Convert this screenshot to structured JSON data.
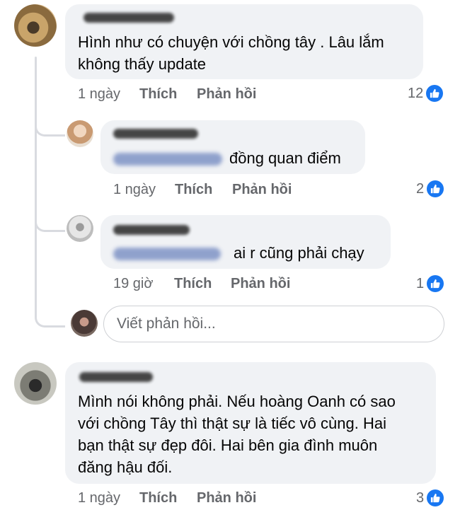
{
  "comments": [
    {
      "text": "Hình như có chuyện với chồng tây . Lâu lắm\nkhông thấy update",
      "time": "1 ngày",
      "like_label": "Thích",
      "reply_label": "Phản hồi",
      "reactions": "12"
    },
    {
      "text": "đồng quan điểm",
      "time": "1 ngày",
      "like_label": "Thích",
      "reply_label": "Phản hồi",
      "reactions": "2"
    },
    {
      "text": "ai r cũng phải chạy",
      "time": "19 giờ",
      "like_label": "Thích",
      "reply_label": "Phản hồi",
      "reactions": "1"
    },
    {
      "text": "Mình nói không phải. Nếu hoàng Oanh có sao\nvới chồng Tây thì thật sự là tiếc vô cùng. Hai\nbạn thật sự đẹp đôi. Hai bên gia đình muôn\nđăng hậu đối.",
      "time": "1 ngày",
      "like_label": "Thích",
      "reply_label": "Phản hồi",
      "reactions": "3"
    }
  ],
  "reply_box": {
    "placeholder": "Viết phản hồi..."
  },
  "colors": {
    "bubble": "#f0f2f5",
    "like_blue": "#1877f2",
    "meta_gray": "#65676b"
  },
  "icons": {
    "like": "thumbs-up-icon"
  }
}
